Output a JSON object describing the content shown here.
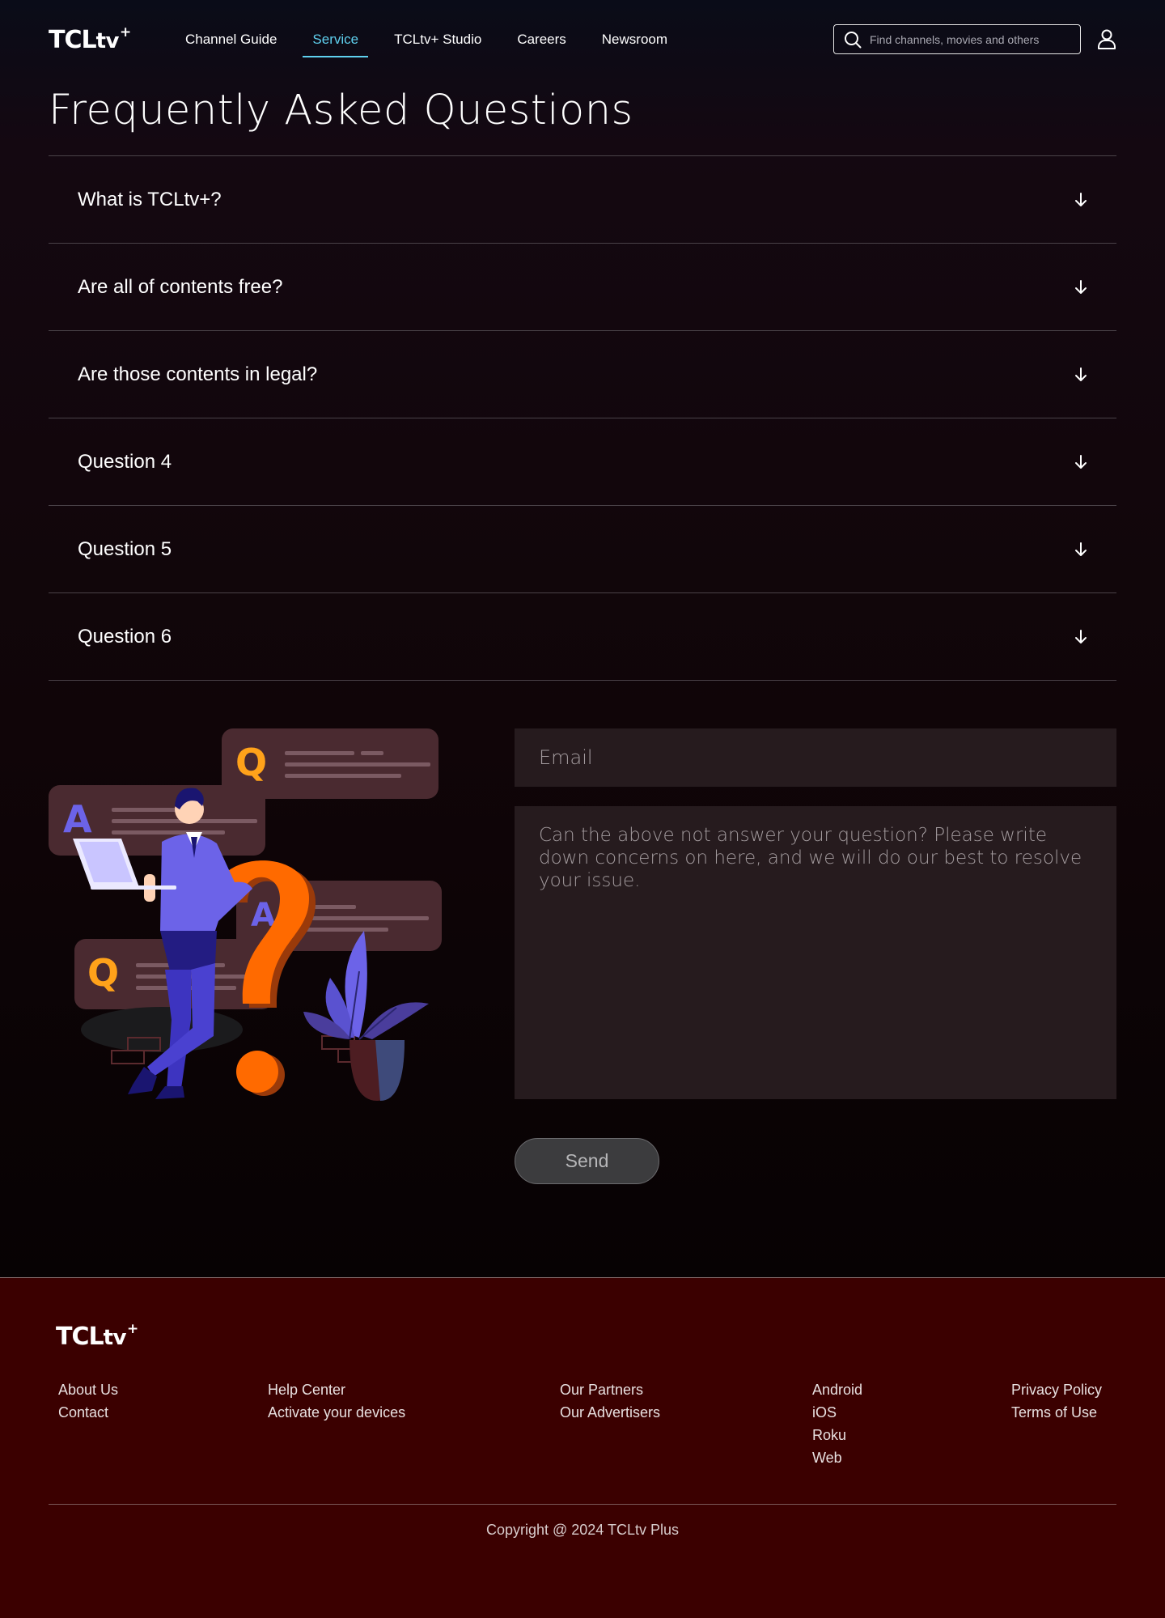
{
  "brand": {
    "logo_main": "TCL",
    "logo_tv": "tv",
    "logo_plus": "+"
  },
  "nav": {
    "items": [
      {
        "label": "Channel Guide"
      },
      {
        "label": "Service",
        "active": true
      },
      {
        "label": "TCLtv+ Studio"
      },
      {
        "label": "Careers"
      },
      {
        "label": "Newsroom"
      }
    ]
  },
  "search": {
    "placeholder": "Find channels, movies and others",
    "icon": "search-icon"
  },
  "user": {
    "icon": "user-icon"
  },
  "page_title": "Frequently Asked Questions",
  "faq": {
    "items": [
      {
        "question": "What is TCLtv+?"
      },
      {
        "question": "Are all of contents free?"
      },
      {
        "question": "Are those contents in legal?"
      },
      {
        "question": "Question 4"
      },
      {
        "question": "Question 5"
      },
      {
        "question": "Question 6"
      }
    ],
    "expand_icon": "arrow-down-icon"
  },
  "contact": {
    "email_placeholder": "Email",
    "message_placeholder": "Can the above not answer your question? Please write down concerns on here, and we will do our best to resolve your issue.",
    "send_label": "Send",
    "illustration": {
      "q_letter": "Q",
      "a_letter": "A"
    }
  },
  "footer": {
    "columns": [
      [
        "About Us",
        "Contact"
      ],
      [
        "Help Center",
        "Activate your devices"
      ],
      [
        "Our Partners",
        "Our Advertisers"
      ],
      [
        "Android",
        "iOS",
        "Roku",
        "Web"
      ],
      [
        "Privacy Policy",
        "Terms of Use"
      ]
    ],
    "copyright": "Copyright @ 2024 TCLtv Plus"
  },
  "colors": {
    "accent": "#5fd0ee",
    "footer_bg": "#3b0000",
    "orange": "#ff6a00",
    "purple": "#6c63e8"
  }
}
